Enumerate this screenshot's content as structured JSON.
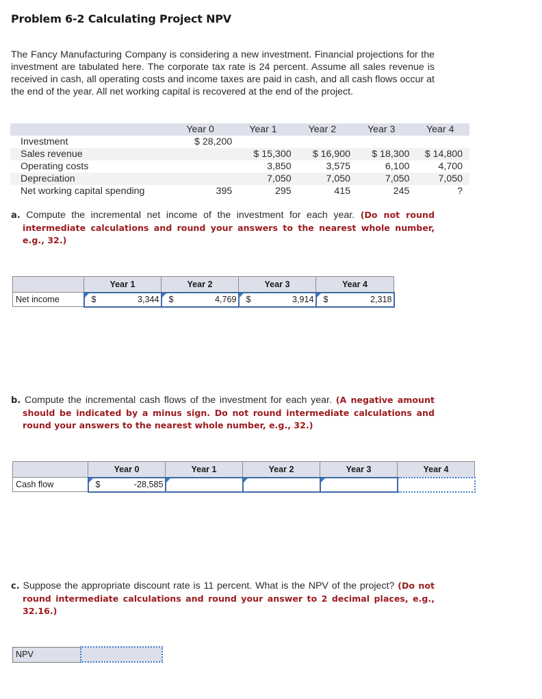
{
  "title": "Problem 6-2 Calculating Project NPV",
  "intro": "The Fancy Manufacturing Company is considering a new investment. Financial projections for the investment are tabulated here. The corporate tax rate is 24 percent. Assume all sales revenue is received in cash, all operating costs and income taxes are paid in cash, and all cash flows occur at the end of the year. All net working capital is recovered at the end of the project.",
  "projections": {
    "headers": [
      "",
      "Year 0",
      "Year 1",
      "Year 2",
      "Year 3",
      "Year 4"
    ],
    "rows": [
      {
        "label": "Investment",
        "values": [
          "$ 28,200",
          "",
          "",
          "",
          ""
        ]
      },
      {
        "label": "Sales revenue",
        "values": [
          "",
          "$ 15,300",
          "$ 16,900",
          "$ 18,300",
          "$ 14,800"
        ]
      },
      {
        "label": "Operating costs",
        "values": [
          "",
          "3,850",
          "3,575",
          "6,100",
          "4,700"
        ]
      },
      {
        "label": "Depreciation",
        "values": [
          "",
          "7,050",
          "7,050",
          "7,050",
          "7,050"
        ]
      },
      {
        "label": "Net working capital spending",
        "values": [
          "395",
          "295",
          "415",
          "245",
          "?"
        ]
      }
    ]
  },
  "part_a": {
    "letter": "a.",
    "question": "Compute the incremental net income of the investment for each year.",
    "note": "(Do not round intermediate calculations and round your answers to the nearest whole number, e.g., 32.)",
    "headers": [
      "",
      "Year 1",
      "Year 2",
      "Year 3",
      "Year 4"
    ],
    "row_label": "Net income",
    "currency": "$",
    "values": [
      "3,344",
      "4,769",
      "3,914",
      "2,318"
    ]
  },
  "part_b": {
    "letter": "b.",
    "question": "Compute the incremental cash flows of the investment for each year.",
    "note": "(A negative amount should be indicated by a minus sign. Do not round intermediate calculations and round your answers to the nearest whole number, e.g., 32.)",
    "headers": [
      "",
      "Year 0",
      "Year 1",
      "Year 2",
      "Year 3",
      "Year 4"
    ],
    "row_label": "Cash flow",
    "currency": "$",
    "values": [
      "-28,585",
      "",
      "",
      "",
      ""
    ]
  },
  "part_c": {
    "letter": "c.",
    "question": "Suppose the appropriate discount rate is 11 percent. What is the NPV of the project?",
    "note": "(Do not round intermediate calculations and round your answer to 2 decimal places, e.g., 32.16.)",
    "row_label": "NPV",
    "value": ""
  }
}
